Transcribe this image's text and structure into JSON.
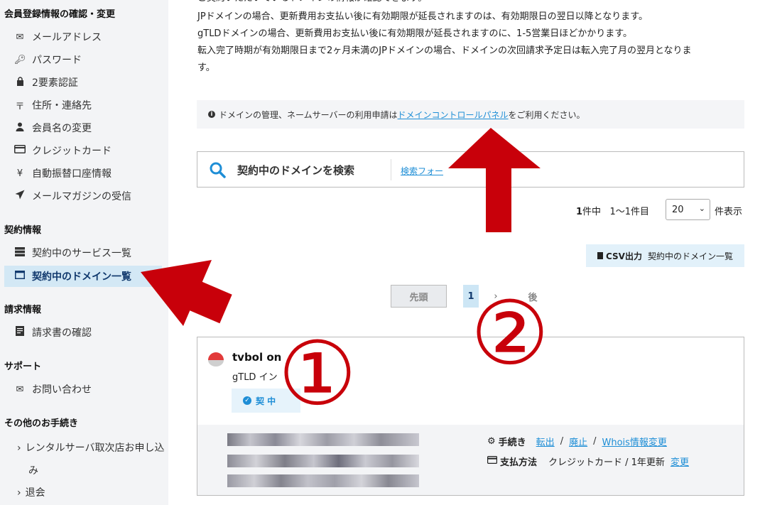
{
  "sidebar": {
    "sections": {
      "member": "会員登録情報の確認・変更",
      "contract": "契約情報",
      "billing": "請求情報",
      "support": "サポート",
      "other": "その他のお手続き"
    },
    "items": {
      "email": "メールアドレス",
      "password": "パスワード",
      "twofa": "2要素認証",
      "address": "住所・連絡先",
      "name_change": "会員名の変更",
      "credit_card": "クレジットカード",
      "auto_debit": "自動振替口座情報",
      "mail_magazine": "メールマガジンの受信",
      "service_list": "契約中のサービス一覧",
      "domain_list": "契約中のドメイン一覧",
      "invoice": "請求書の確認",
      "contact": "お問い合わせ",
      "reseller_line1": "レンタルサーバ取次店お申し込",
      "reseller_line2": "み",
      "withdraw": "退会"
    }
  },
  "main": {
    "intro_partial": "ご契約いただいているドメインの情報が確認できます。",
    "notes": [
      "JPドメインの場合、更新費用お支払い後に有効期限が延長されますのは、有効期限日の翌日以降となります。",
      "gTLDドメインの場合、更新費用お支払い後に有効期限が延長されますのに、1-5営業日ほどかかります。",
      "転入完了時期が有効期限日まで2ヶ月未満のJPドメインの場合、ドメインの次回請求予定日は転入完了月の翌月となりま",
      "す。"
    ],
    "notice": {
      "prefix": "ドメインの管理、ネームサーバーの利用申請は",
      "link": "ドメインコントロールパネル",
      "suffix": "をご利用ください。"
    },
    "search": {
      "title": "契約中のドメインを検索",
      "link": "検索フォー"
    },
    "count": {
      "total": "1",
      "total_suffix": "件中",
      "range": "1〜1件目",
      "per_page_value": "20",
      "per_page_label": "件表示"
    },
    "csv": {
      "label": "CSV出力",
      "desc": "契約中のドメイン一覧"
    },
    "pager": {
      "first": "先頭",
      "current": "1",
      "next": "›",
      "last_partial": "後"
    },
    "domain_card": {
      "name_partial": "tvbol   on",
      "type_partial": "gTLD   イン",
      "status_partial": "契   中",
      "procedures_label": "手続き",
      "proc_transfer": "転出",
      "proc_cancel": "廃止",
      "proc_whois": "Whois情報変更",
      "payment_label": "支払方法",
      "payment_value": "クレジットカード / 1年更新",
      "payment_change": "変更"
    }
  },
  "annotations": {
    "marker1": "①",
    "marker2": "②",
    "color": "#c8000a"
  }
}
